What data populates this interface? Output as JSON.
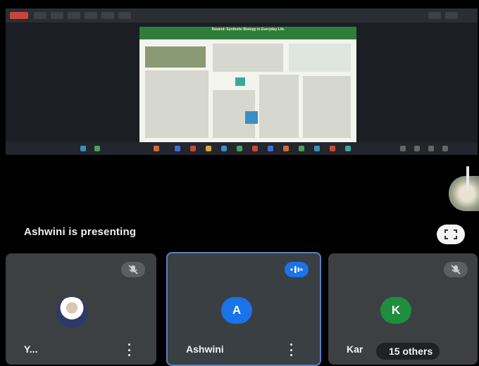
{
  "shared_screen": {
    "slide_title": "Rewind: Synthetic Biology in Everyday Life"
  },
  "stage": {
    "presenting_text": "Ashwini is presenting"
  },
  "participants": [
    {
      "name": "Y...",
      "avatar_type": "photo",
      "mic": "muted",
      "mute_icon": "mic-off-icon"
    },
    {
      "name": "Ashwini",
      "avatar_letter": "A",
      "avatar_color": "#1a73e8",
      "mic": "speaking",
      "speaking_icon": "audio-wave-icon"
    },
    {
      "name": "Kar",
      "avatar_letter": "K",
      "avatar_color": "#1e8e3e",
      "mic": "muted",
      "mute_icon": "mic-off-icon"
    }
  ],
  "others_chip": {
    "label": "15 others"
  },
  "colors": {
    "tile_bg": "#3c4043",
    "active_border": "#5a7fc4",
    "speaking_blue": "#1a73e8",
    "presenter_avatar": "#1a73e8",
    "k_avatar": "#1e8e3e"
  }
}
